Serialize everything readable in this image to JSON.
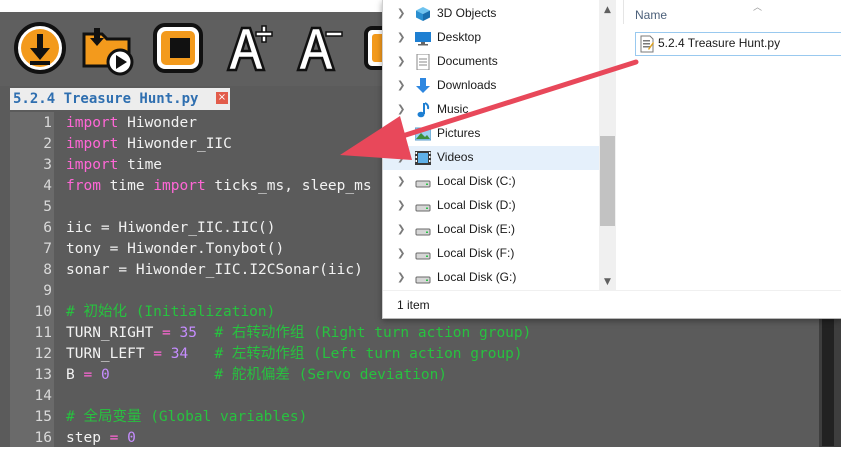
{
  "editor": {
    "tab_title": "5.2.4 Treasure Hunt.py",
    "tab_close": "×",
    "toolbar": [
      {
        "name": "download-button",
        "icon": "download-icon"
      },
      {
        "name": "run-button",
        "icon": "folder-play-icon"
      },
      {
        "name": "stop-button",
        "icon": "stop-icon"
      },
      {
        "name": "font-increase-button",
        "icon": "font-increase-icon"
      },
      {
        "name": "font-decrease-button",
        "icon": "font-decrease-icon"
      },
      {
        "name": "more-button",
        "icon": "partial-icon"
      }
    ],
    "line_numbers": [
      "1",
      "2",
      "3",
      "4",
      "5",
      "6",
      "7",
      "8",
      "9",
      "10",
      "11",
      "12",
      "13",
      "14",
      "15",
      "16"
    ],
    "code": {
      "l1": {
        "kw": "import",
        "rest": " Hiwonder"
      },
      "l2": {
        "kw": "import",
        "rest": " Hiwonder_IIC"
      },
      "l3": {
        "kw": "import",
        "rest": " time"
      },
      "l4": {
        "kw1": "from",
        "mid": " time ",
        "kw2": "import",
        "rest": " ticks_ms, sleep_ms"
      },
      "l6": {
        "text": "iic = Hiwonder_IIC.IIC()"
      },
      "l7": {
        "text": "tony = Hiwonder.Tonybot()"
      },
      "l8": {
        "text": "sonar = Hiwonder_IIC.I2CSonar(iic)"
      },
      "l10": {
        "comment": "# 初始化 (Initialization)"
      },
      "l11": {
        "name": "TURN_RIGHT",
        "eq": " = ",
        "num": "35",
        "comment": "  # 右转动作组 (Right turn action group)"
      },
      "l12": {
        "name": "TURN_LEFT",
        "eq": " = ",
        "num": "34",
        "comment": "   # 左转动作组 (Left turn action group)"
      },
      "l13": {
        "name": "B",
        "eq": " = ",
        "num": "0",
        "comment": "            # 舵机偏差 (Servo deviation)"
      },
      "l15": {
        "comment": "# 全局变量 (Global variables)"
      },
      "l16": {
        "name": "step",
        "eq": " = ",
        "num": "0"
      }
    }
  },
  "explorer": {
    "nav_items": [
      {
        "label": "3D Objects",
        "icon": "3d-objects-icon",
        "selected": false
      },
      {
        "label": "Desktop",
        "icon": "desktop-icon",
        "selected": false
      },
      {
        "label": "Documents",
        "icon": "documents-icon",
        "selected": false
      },
      {
        "label": "Downloads",
        "icon": "downloads-icon",
        "selected": false
      },
      {
        "label": "Music",
        "icon": "music-icon",
        "selected": false
      },
      {
        "label": "Pictures",
        "icon": "pictures-icon",
        "selected": false
      },
      {
        "label": "Videos",
        "icon": "videos-icon",
        "selected": true
      },
      {
        "label": "Local Disk (C:)",
        "icon": "drive-icon",
        "selected": false
      },
      {
        "label": "Local Disk (D:)",
        "icon": "drive-icon",
        "selected": false
      },
      {
        "label": "Local Disk (E:)",
        "icon": "drive-icon",
        "selected": false
      },
      {
        "label": "Local Disk (F:)",
        "icon": "drive-icon",
        "selected": false
      },
      {
        "label": "Local Disk (G:)",
        "icon": "drive-icon",
        "selected": false
      }
    ],
    "column_header": "Name",
    "file": {
      "label": "5.2.4 Treasure Hunt.py",
      "icon": "python-file-icon"
    },
    "status": "1 item"
  },
  "colors": {
    "accent_orange": "#f39a1c",
    "arrow_red": "#e8485a",
    "keyword_pink": "#ff67d6",
    "comment_green": "#27c23f"
  }
}
